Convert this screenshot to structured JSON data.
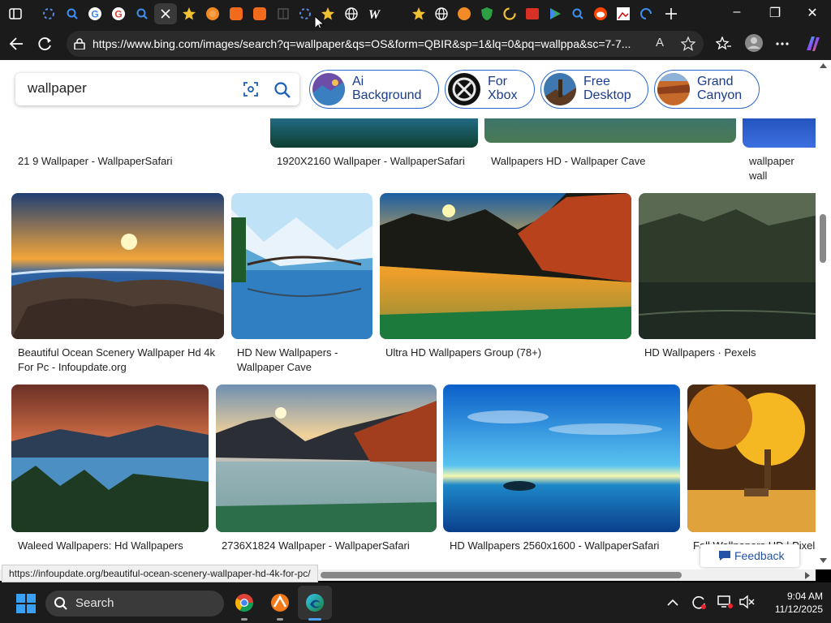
{
  "browser": {
    "url": "https://www.bing.com/images/search?q=wallpaper&qs=OS&form=QBIR&sp=1&lq=0&pq=wallppa&sc=7-7...",
    "read_aloud_label": "A",
    "status_url": "https://infoupdate.org/beautiful-ocean-scenery-wallpaper-hd-4k-for-pc/"
  },
  "search": {
    "query": "wallpaper"
  },
  "chips": [
    {
      "line1": "Ai",
      "line2": "Background"
    },
    {
      "line1": "For",
      "line2": "Xbox"
    },
    {
      "line1": "Free",
      "line2": "Desktop"
    },
    {
      "line1": "Grand",
      "line2": "Canyon"
    }
  ],
  "row1": [
    {
      "caption": "21 9 Wallpaper - WallpaperSafari"
    },
    {
      "caption": "1920X2160 Wallpaper - WallpaperSafari"
    },
    {
      "caption": "Wallpapers HD - Wallpaper Cave"
    },
    {
      "caption": "wallpaper wall wallpapers"
    }
  ],
  "row2": [
    {
      "caption": "Beautiful Ocean Scenery Wallpaper Hd 4k For Pc - Infoupdate.org"
    },
    {
      "caption": "HD New Wallpapers - Wallpaper Cave"
    },
    {
      "caption": "Ultra HD Wallpapers Group (78+)"
    },
    {
      "caption": "HD Wallpapers · Pexels"
    }
  ],
  "row3": [
    {
      "caption": "Waleed Wallpapers: Hd Wallpapers"
    },
    {
      "caption": "2736X1824 Wallpaper - WallpaperSafari"
    },
    {
      "caption": "HD Wallpapers 2560x1600 - WallpaperSafari"
    },
    {
      "caption": "Fall Wallpapers HD | Pixels"
    }
  ],
  "feedback_label": "Feedback",
  "taskbar": {
    "search_label": "Search",
    "time": "9:04 AM",
    "date": "11/12/2025"
  },
  "colors": {
    "accent": "#2b68c9",
    "chip_text": "#1a3c8e",
    "taskbar": "#1c1c1c"
  }
}
